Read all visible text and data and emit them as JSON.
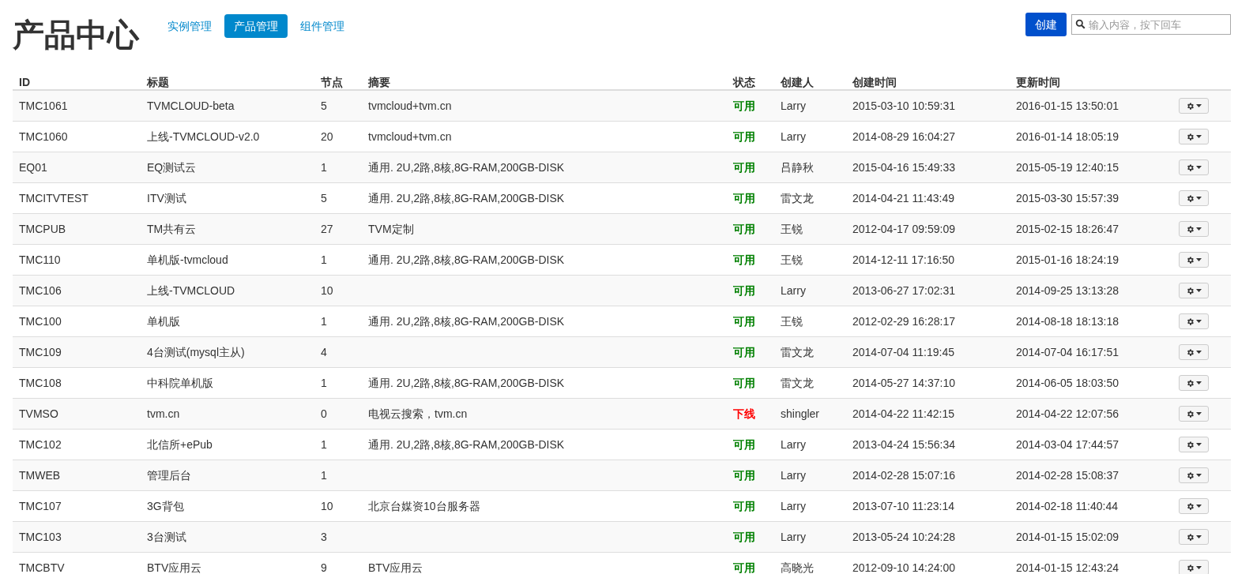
{
  "page_title": "产品中心",
  "nav_tabs": [
    {
      "label": "实例管理",
      "selected": false
    },
    {
      "label": "产品管理",
      "selected": true
    },
    {
      "label": "组件管理",
      "selected": false
    }
  ],
  "create_button": "创建",
  "search": {
    "placeholder": "输入内容，按下回车"
  },
  "table": {
    "columns": [
      "ID",
      "标题",
      "节点",
      "摘要",
      "状态",
      "创建人",
      "创建时间",
      "更新时间"
    ],
    "rows": [
      {
        "id": "TMC1061",
        "title": "TVMCLOUD-beta",
        "nodes": "5",
        "summary": "tvmcloud+tvm.cn",
        "status": {
          "text": "可用",
          "kind": "available"
        },
        "creator": "Larry",
        "created": "2015-03-10 10:59:31",
        "updated": "2016-01-15 13:50:01"
      },
      {
        "id": "TMC1060",
        "title": "上线-TVMCLOUD-v2.0",
        "nodes": "20",
        "summary": "tvmcloud+tvm.cn",
        "status": {
          "text": "可用",
          "kind": "available"
        },
        "creator": "Larry",
        "created": "2014-08-29 16:04:27",
        "updated": "2016-01-14 18:05:19"
      },
      {
        "id": "EQ01",
        "title": "EQ测试云",
        "nodes": "1",
        "summary": "通用. 2U,2路,8核,8G-RAM,200GB-DISK",
        "status": {
          "text": "可用",
          "kind": "available"
        },
        "creator": "吕静秋",
        "created": "2015-04-16 15:49:33",
        "updated": "2015-05-19 12:40:15"
      },
      {
        "id": "TMCITVTEST",
        "title": "ITV测试",
        "nodes": "5",
        "summary": "通用. 2U,2路,8核,8G-RAM,200GB-DISK",
        "status": {
          "text": "可用",
          "kind": "available"
        },
        "creator": "雷文龙",
        "created": "2014-04-21 11:43:49",
        "updated": "2015-03-30 15:57:39"
      },
      {
        "id": "TMCPUB",
        "title": "TM共有云",
        "nodes": "27",
        "summary": "TVM定制",
        "status": {
          "text": "可用",
          "kind": "available"
        },
        "creator": "王锐",
        "created": "2012-04-17 09:59:09",
        "updated": "2015-02-15 18:26:47"
      },
      {
        "id": "TMC110",
        "title": "单机版-tvmcloud",
        "nodes": "1",
        "summary": "通用. 2U,2路,8核,8G-RAM,200GB-DISK",
        "status": {
          "text": "可用",
          "kind": "available"
        },
        "creator": "王锐",
        "created": "2014-12-11 17:16:50",
        "updated": "2015-01-16 18:24:19"
      },
      {
        "id": "TMC106",
        "title": "上线-TVMCLOUD",
        "nodes": "10",
        "summary": "",
        "status": {
          "text": "可用",
          "kind": "available"
        },
        "creator": "Larry",
        "created": "2013-06-27 17:02:31",
        "updated": "2014-09-25 13:13:28"
      },
      {
        "id": "TMC100",
        "title": "单机版",
        "nodes": "1",
        "summary": "通用. 2U,2路,8核,8G-RAM,200GB-DISK",
        "status": {
          "text": "可用",
          "kind": "available"
        },
        "creator": "王锐",
        "created": "2012-02-29 16:28:17",
        "updated": "2014-08-18 18:13:18"
      },
      {
        "id": "TMC109",
        "title": "4台测试(mysql主从)",
        "nodes": "4",
        "summary": "",
        "status": {
          "text": "可用",
          "kind": "available"
        },
        "creator": "雷文龙",
        "created": "2014-07-04 11:19:45",
        "updated": "2014-07-04 16:17:51"
      },
      {
        "id": "TMC108",
        "title": "中科院单机版",
        "nodes": "1",
        "summary": "通用. 2U,2路,8核,8G-RAM,200GB-DISK",
        "status": {
          "text": "可用",
          "kind": "available"
        },
        "creator": "雷文龙",
        "created": "2014-05-27 14:37:10",
        "updated": "2014-06-05 18:03:50"
      },
      {
        "id": "TVMSO",
        "title": "tvm.cn",
        "nodes": "0",
        "summary": "电视云搜索，tvm.cn",
        "status": {
          "text": "下线",
          "kind": "offline"
        },
        "creator": "shingler",
        "created": "2014-04-22 11:42:15",
        "updated": "2014-04-22 12:07:56"
      },
      {
        "id": "TMC102",
        "title": "北信所+ePub",
        "nodes": "1",
        "summary": "通用. 2U,2路,8核,8G-RAM,200GB-DISK",
        "status": {
          "text": "可用",
          "kind": "available"
        },
        "creator": "Larry",
        "created": "2013-04-24 15:56:34",
        "updated": "2014-03-04 17:44:57"
      },
      {
        "id": "TMWEB",
        "title": "管理后台",
        "nodes": "1",
        "summary": "",
        "status": {
          "text": "可用",
          "kind": "available"
        },
        "creator": "Larry",
        "created": "2014-02-28 15:07:16",
        "updated": "2014-02-28 15:08:37"
      },
      {
        "id": "TMC107",
        "title": "3G背包",
        "nodes": "10",
        "summary": "北京台媒资10台服务器",
        "status": {
          "text": "可用",
          "kind": "available"
        },
        "creator": "Larry",
        "created": "2013-07-10 11:23:14",
        "updated": "2014-02-18 11:40:44"
      },
      {
        "id": "TMC103",
        "title": "3台测试",
        "nodes": "3",
        "summary": "",
        "status": {
          "text": "可用",
          "kind": "available"
        },
        "creator": "Larry",
        "created": "2013-05-24 10:24:28",
        "updated": "2014-01-15 15:02:09"
      },
      {
        "id": "TMCBTV",
        "title": "BTV应用云",
        "nodes": "9",
        "summary": "BTV应用云",
        "status": {
          "text": "可用",
          "kind": "available"
        },
        "creator": "高晓光",
        "created": "2012-09-10 14:24:00",
        "updated": "2014-01-15 12:43:24"
      }
    ]
  }
}
